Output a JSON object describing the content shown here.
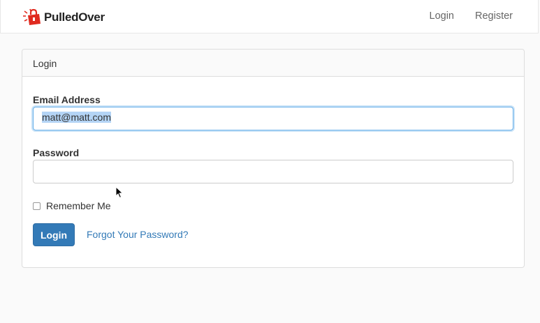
{
  "brand": {
    "name": "PulledOver",
    "icon": "lock-logo-icon",
    "logo_color": "#e02b20"
  },
  "nav": {
    "items": [
      {
        "label": "Login"
      },
      {
        "label": "Register"
      }
    ]
  },
  "panel": {
    "heading": "Login",
    "email": {
      "label": "Email Address",
      "value": "matt@matt.com"
    },
    "password": {
      "label": "Password",
      "value": ""
    },
    "remember": {
      "label": "Remember Me",
      "checked": false
    },
    "submit_label": "Login",
    "forgot_label": "Forgot Your Password?"
  },
  "colors": {
    "primary": "#337ab7",
    "focus": "#66afe9",
    "selection": "#b4d4f5"
  }
}
